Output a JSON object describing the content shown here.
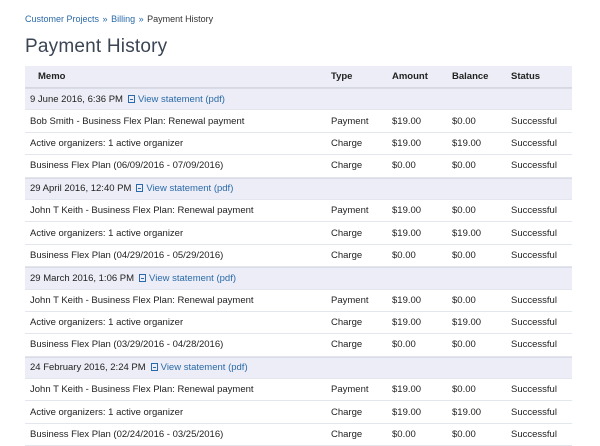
{
  "breadcrumb": {
    "item1": "Customer Projects",
    "sep": "»",
    "item2": "Billing",
    "current": "Payment History"
  },
  "page_title": "Payment History",
  "table": {
    "headers": {
      "memo": "Memo",
      "type": "Type",
      "amount": "Amount",
      "balance": "Balance",
      "status": "Status"
    },
    "groups": [
      {
        "date": "9 June 2016, 6:36 PM",
        "link": "View statement (pdf)",
        "rows": [
          {
            "memo": "Bob Smith - Business Flex Plan: Renewal payment",
            "type": "Payment",
            "amount": "$19.00",
            "balance": "$0.00",
            "status": "Successful"
          },
          {
            "memo": "Active organizers: 1 active organizer",
            "type": "Charge",
            "amount": "$19.00",
            "balance": "$19.00",
            "status": "Successful"
          },
          {
            "memo": "Business Flex Plan (06/09/2016 - 07/09/2016)",
            "type": "Charge",
            "amount": "$0.00",
            "balance": "$0.00",
            "status": "Successful"
          }
        ]
      },
      {
        "date": "29 April 2016, 12:40 PM",
        "link": "View statement (pdf)",
        "rows": [
          {
            "memo": "John T Keith - Business Flex Plan: Renewal payment",
            "type": "Payment",
            "amount": "$19.00",
            "balance": "$0.00",
            "status": "Successful"
          },
          {
            "memo": "Active organizers: 1 active organizer",
            "type": "Charge",
            "amount": "$19.00",
            "balance": "$19.00",
            "status": "Successful"
          },
          {
            "memo": "Business Flex Plan (04/29/2016 - 05/29/2016)",
            "type": "Charge",
            "amount": "$0.00",
            "balance": "$0.00",
            "status": "Successful"
          }
        ]
      },
      {
        "date": "29 March 2016, 1:06 PM",
        "link": "View statement (pdf)",
        "rows": [
          {
            "memo": "John T Keith - Business Flex Plan: Renewal payment",
            "type": "Payment",
            "amount": "$19.00",
            "balance": "$0.00",
            "status": "Successful"
          },
          {
            "memo": "Active organizers: 1 active organizer",
            "type": "Charge",
            "amount": "$19.00",
            "balance": "$19.00",
            "status": "Successful"
          },
          {
            "memo": "Business Flex Plan (03/29/2016 - 04/28/2016)",
            "type": "Charge",
            "amount": "$0.00",
            "balance": "$0.00",
            "status": "Successful"
          }
        ]
      },
      {
        "date": "24 February 2016, 2:24 PM",
        "link": "View statement (pdf)",
        "rows": [
          {
            "memo": "John T Keith - Business Flex Plan: Renewal payment",
            "type": "Payment",
            "amount": "$19.00",
            "balance": "$0.00",
            "status": "Successful"
          },
          {
            "memo": "Active organizers: 1 active organizer",
            "type": "Charge",
            "amount": "$19.00",
            "balance": "$19.00",
            "status": "Successful"
          },
          {
            "memo": "Business Flex Plan (02/24/2016 - 03/25/2016)",
            "type": "Charge",
            "amount": "$0.00",
            "balance": "$0.00",
            "status": "Successful"
          }
        ]
      }
    ]
  }
}
